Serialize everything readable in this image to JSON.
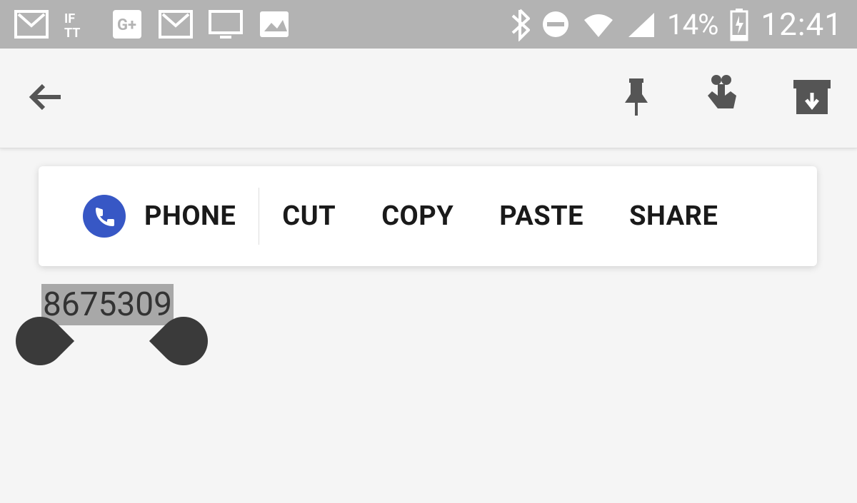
{
  "status_bar": {
    "battery_percent": "14%",
    "clock": "12:41"
  },
  "context_menu": {
    "phone": "PHONE",
    "cut": "CUT",
    "copy": "COPY",
    "paste": "PASTE",
    "share": "SHARE"
  },
  "selection": {
    "text": "8675309"
  }
}
